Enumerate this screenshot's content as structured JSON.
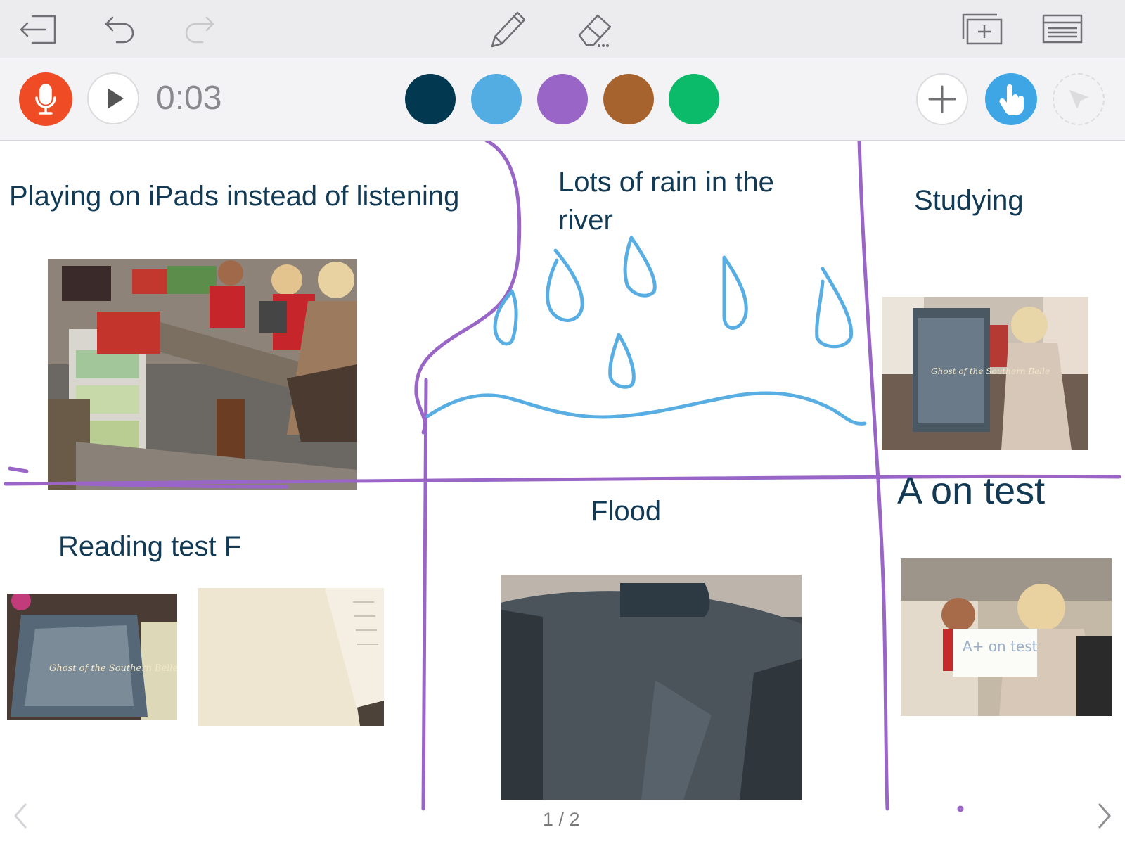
{
  "window": {
    "top_icons": [
      "exit-icon",
      "undo-icon",
      "redo-icon",
      "pencil-icon",
      "eraser-icon",
      "add-slide-icon",
      "slides-list-icon"
    ]
  },
  "recording": {
    "timer": "0:03"
  },
  "colors": {
    "ink_purple": "#9966c7",
    "ink_blue": "#58ade3",
    "text_dark": "#123a55",
    "record_red": "#ef4b24",
    "pointer_blue": "#3fa6e6"
  },
  "palette": [
    {
      "name": "dark-navy",
      "hex": "#033950"
    },
    {
      "name": "sky-blue",
      "hex": "#54ade2"
    },
    {
      "name": "purple",
      "hex": "#9966c7"
    },
    {
      "name": "brown",
      "hex": "#a7632e"
    },
    {
      "name": "green",
      "hex": "#0bbb6a"
    }
  ],
  "canvas": {
    "labels": {
      "ipads": "Playing on iPads instead of listening",
      "rain": "Lots of rain in the\nriver",
      "studying": "Studying",
      "reading": "Reading test F",
      "flood": "Flood",
      "a_on_test": "A on test"
    },
    "photos": [
      {
        "id": "photo-classroom-ipads"
      },
      {
        "id": "photo-girl-book"
      },
      {
        "id": "photo-book-ghost"
      },
      {
        "id": "photo-paper"
      },
      {
        "id": "photo-backpack"
      },
      {
        "id": "photo-girl-card"
      }
    ],
    "photo_text": {
      "book_title": "Ghost of the Southern Belle",
      "card_text": "A+ on test"
    }
  },
  "pagination": {
    "page_indicator": "1 / 2"
  }
}
